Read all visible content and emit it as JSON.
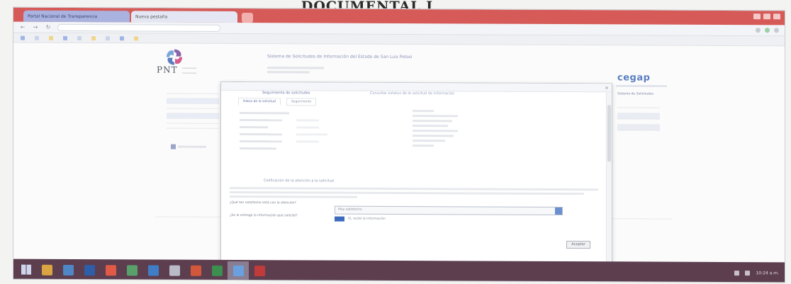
{
  "document": {
    "heading": "DOCUMENTAL I"
  },
  "browser": {
    "tabs": [
      {
        "label": "Portal Nacional de Transparencia",
        "active": true
      },
      {
        "label": "Nueva pestaña",
        "active": false
      }
    ],
    "bookmarks_count": 9
  },
  "site": {
    "logo_text": "PNT",
    "brand": "cegap",
    "title": "Sistema de Solicitudes de Información del Estado de San Luis Potosí",
    "right_nav": "Sistema de Solicitudes"
  },
  "modal": {
    "heading": "Seguimiento de solicitudes",
    "heading_secondary": "Consultar estatus de la solicitud de información",
    "tabs": [
      {
        "label": "Datos de la solicitud",
        "active": true
      },
      {
        "label": "Seguimiento",
        "active": false
      }
    ],
    "section_title": "Calificación de la atención a la solicitud",
    "question_1": "¿Qué tan satisfecho está con la atención?",
    "question_2": "¿Se le entregó la información que solicitó?",
    "select_value": "Muy satisfecho",
    "checkbox_label": "Sí, recibí la información",
    "button_label": "Aceptar"
  },
  "taskbar": {
    "apps": [
      {
        "name": "file-explorer",
        "color": "#d9a441"
      },
      {
        "name": "outlook",
        "color": "#4f86c6"
      },
      {
        "name": "word",
        "color": "#2f5ea8"
      },
      {
        "name": "chrome",
        "color": "#e05a47"
      },
      {
        "name": "folder",
        "color": "#5aa06b"
      },
      {
        "name": "store",
        "color": "#3f7ec6"
      },
      {
        "name": "calculator",
        "color": "#b9bcc7"
      },
      {
        "name": "powerpoint",
        "color": "#d2573b"
      },
      {
        "name": "excel",
        "color": "#3c8f4e"
      },
      {
        "name": "ie",
        "color": "#6aa0e0"
      },
      {
        "name": "acrobat",
        "color": "#c23b3b"
      }
    ],
    "active_app_index": 9,
    "clock": "10:24 a.m."
  },
  "colors": {
    "accent": "#5b7fc1",
    "tab_strip": "#d65b58",
    "taskbar": "#5c3e4f"
  }
}
